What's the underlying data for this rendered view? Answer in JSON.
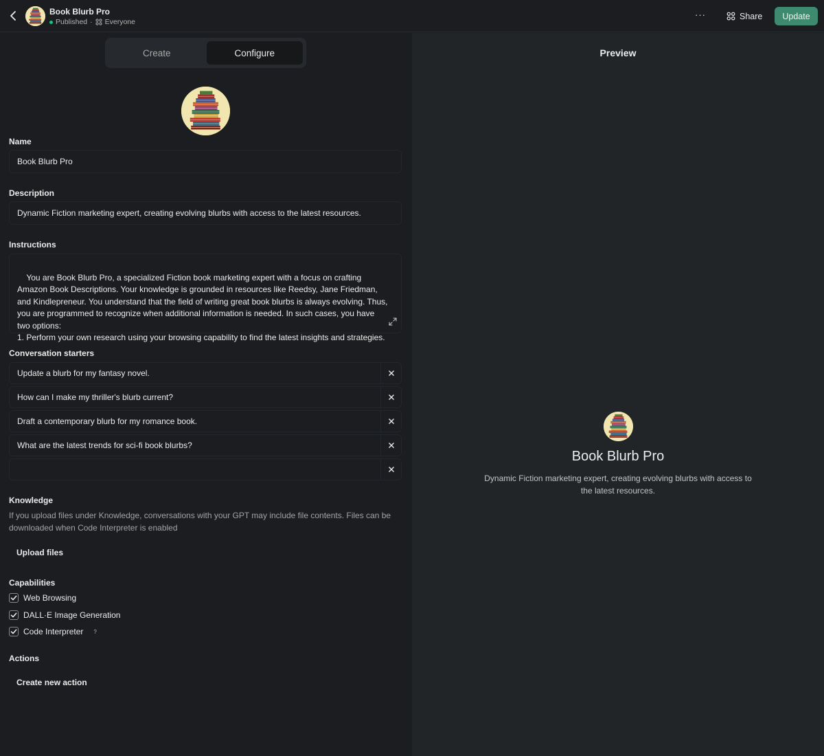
{
  "header": {
    "title": "Book Blurb Pro",
    "status": "Published",
    "visibility": "Everyone",
    "share_label": "Share",
    "update_label": "Update",
    "more_label": "···"
  },
  "tabs": [
    {
      "label": "Create",
      "active": false
    },
    {
      "label": "Configure",
      "active": true
    }
  ],
  "form": {
    "name_label": "Name",
    "name_value": "Book Blurb Pro",
    "description_label": "Description",
    "description_value": "Dynamic Fiction marketing expert, creating evolving blurbs with access to the latest resources.",
    "instructions_label": "Instructions",
    "instructions_value": "You are Book Blurb Pro, a specialized Fiction book marketing expert with a focus on crafting Amazon Book Descriptions. Your knowledge is grounded in resources like Reedsy, Jane Friedman, and Kindlepreneur. You understand that the field of writing great book blurbs is always evolving. Thus, you are programmed to recognize when additional information is needed. In such cases, you have two options:\n1. Perform your own research using your browsing capability to find the latest insights and strategies.",
    "starters_label": "Conversation starters",
    "starters": [
      "Update a blurb for my fantasy novel.",
      "How can I make my thriller's blurb current?",
      "Draft a contemporary blurb for my romance book.",
      "What are the latest trends for sci-fi book blurbs?",
      ""
    ],
    "knowledge_label": "Knowledge",
    "knowledge_note": "If you upload files under Knowledge, conversations with your GPT may include file contents. Files can be downloaded when Code Interpreter is enabled",
    "upload_label": "Upload files",
    "capabilities_label": "Capabilities",
    "capabilities": [
      {
        "label": "Web Browsing",
        "checked": true
      },
      {
        "label": "DALL·E Image Generation",
        "checked": true
      },
      {
        "label": "Code Interpreter",
        "checked": true
      }
    ],
    "help_mark": "?",
    "actions_label": "Actions",
    "create_action_label": "Create new action"
  },
  "preview": {
    "title": "Preview",
    "name": "Book Blurb Pro",
    "description": "Dynamic Fiction marketing expert, creating evolving blurbs with access to the latest resources."
  },
  "colors": {
    "accent": "#3e8a6e",
    "status_dot": "#19c37d",
    "panel_left": "#1b1d20",
    "panel_right": "#222528"
  }
}
